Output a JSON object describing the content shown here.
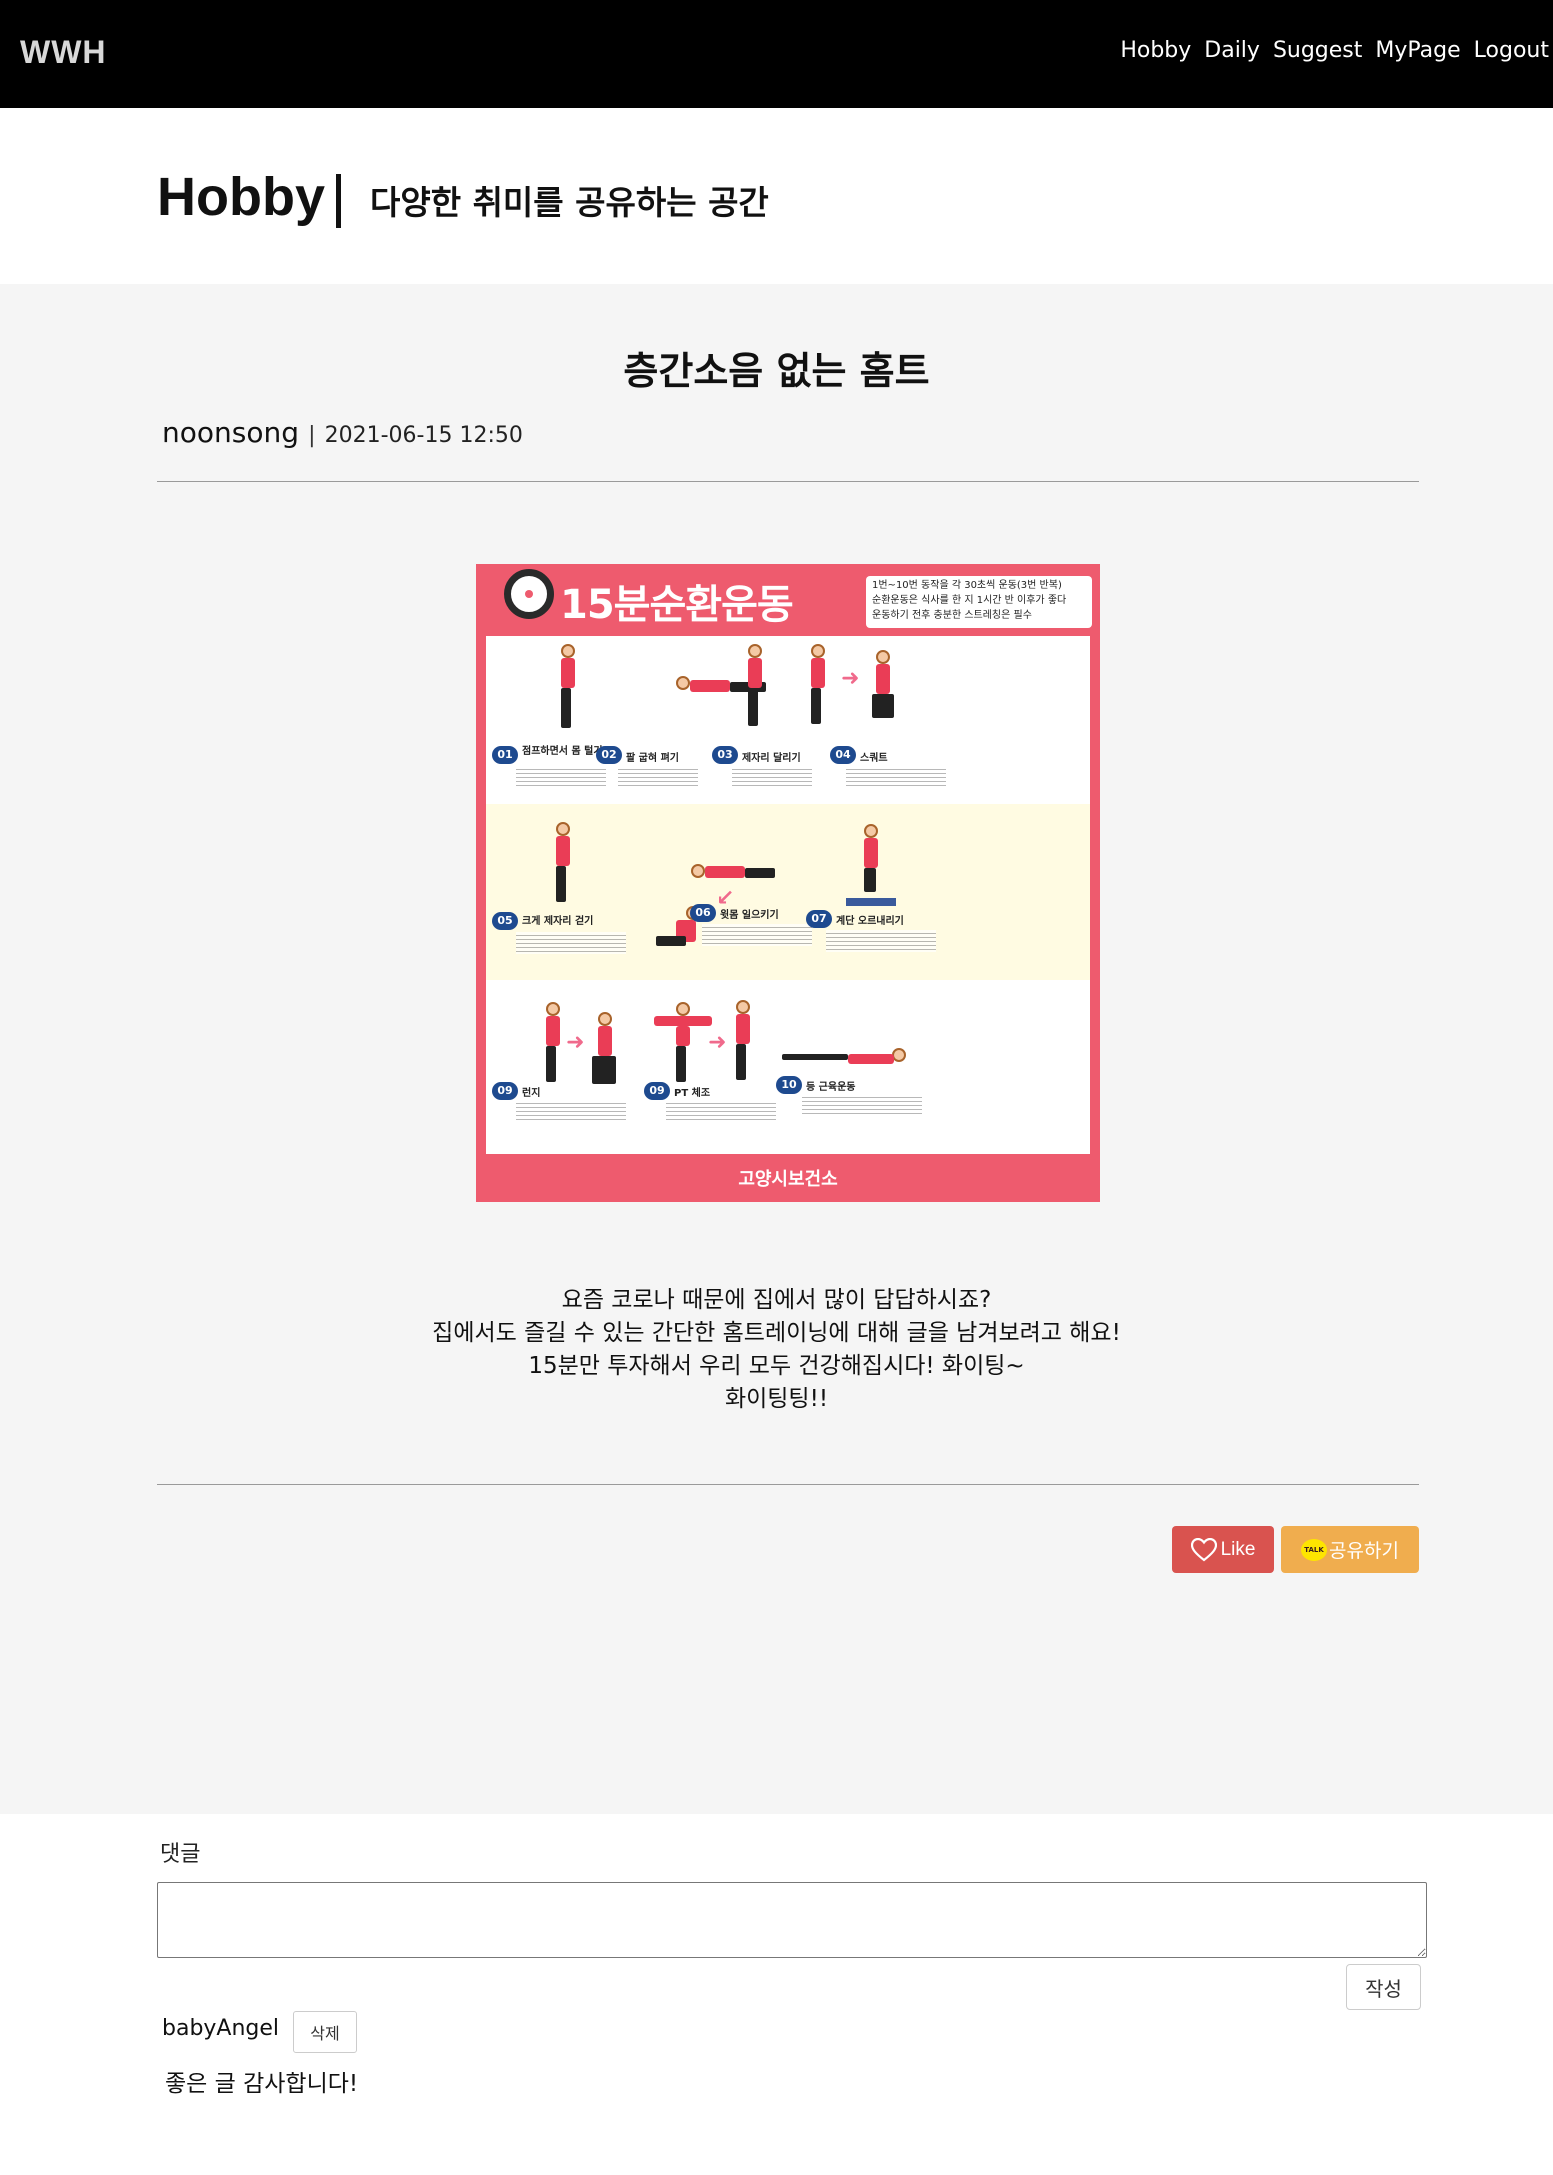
{
  "navbar": {
    "logo": "WWH",
    "links": [
      "Hobby",
      "Daily",
      "Suggest",
      "MyPage",
      "Logout"
    ]
  },
  "header": {
    "title": "Hobby",
    "subtitle": "다양한 취미를 공유하는 공간"
  },
  "post": {
    "title": "층간소음 없는 홈트",
    "author": "noonsong",
    "separator": "|",
    "date": "2021-06-15 12:50",
    "image": {
      "title": "15분순환운동",
      "notes": [
        "1번~10번 동작을 각 30초씩 운동(3번 반복)",
        "순환운동은 식사를 한 지 1시간 반 이후가 좋다",
        "운동하기 전후 충분한 스트레칭은 필수"
      ],
      "exercises": [
        {
          "num": "01",
          "name": "점프하면서 몸 털기"
        },
        {
          "num": "02",
          "name": "팔 굽혀 펴기"
        },
        {
          "num": "03",
          "name": "제자리 달리기"
        },
        {
          "num": "04",
          "name": "스쿼트"
        },
        {
          "num": "05",
          "name": "크게 제자리 걷기"
        },
        {
          "num": "06",
          "name": "윗몸 일으키기"
        },
        {
          "num": "07",
          "name": "계단 오르내리기"
        },
        {
          "num": "09",
          "name": "런지"
        },
        {
          "num": "09",
          "name": "PT 체조"
        },
        {
          "num": "10",
          "name": "등 근육운동"
        }
      ],
      "footer": "고양시보건소"
    },
    "body": [
      "요즘 코로나 때문에 집에서 많이 답답하시죠?",
      "집에서도 즐길 수 있는 간단한 홈트레이닝에 대해 글을 남겨보려고 해요!",
      "15분만 투자해서 우리 모두 건강해집시다! 화이팅~",
      "화이팅팅!!"
    ],
    "like_label": "Like",
    "share_label": "공유하기",
    "kakao_icon_text": "TALK"
  },
  "comments": {
    "label": "댓글",
    "input_placeholder": "",
    "submit_label": "작성",
    "items": [
      {
        "author": "babyAngel",
        "delete_label": "삭제",
        "text": "좋은 글 감사합니다!"
      }
    ]
  },
  "colors": {
    "navbar": "#000000",
    "main_bg": "#f5f5f5",
    "like": "#d9534f",
    "share": "#f0ad4e",
    "poster": "#ee5b6e"
  },
  "icons": [
    "heart-icon",
    "kakao-talk-icon",
    "stopwatch-icon"
  ]
}
